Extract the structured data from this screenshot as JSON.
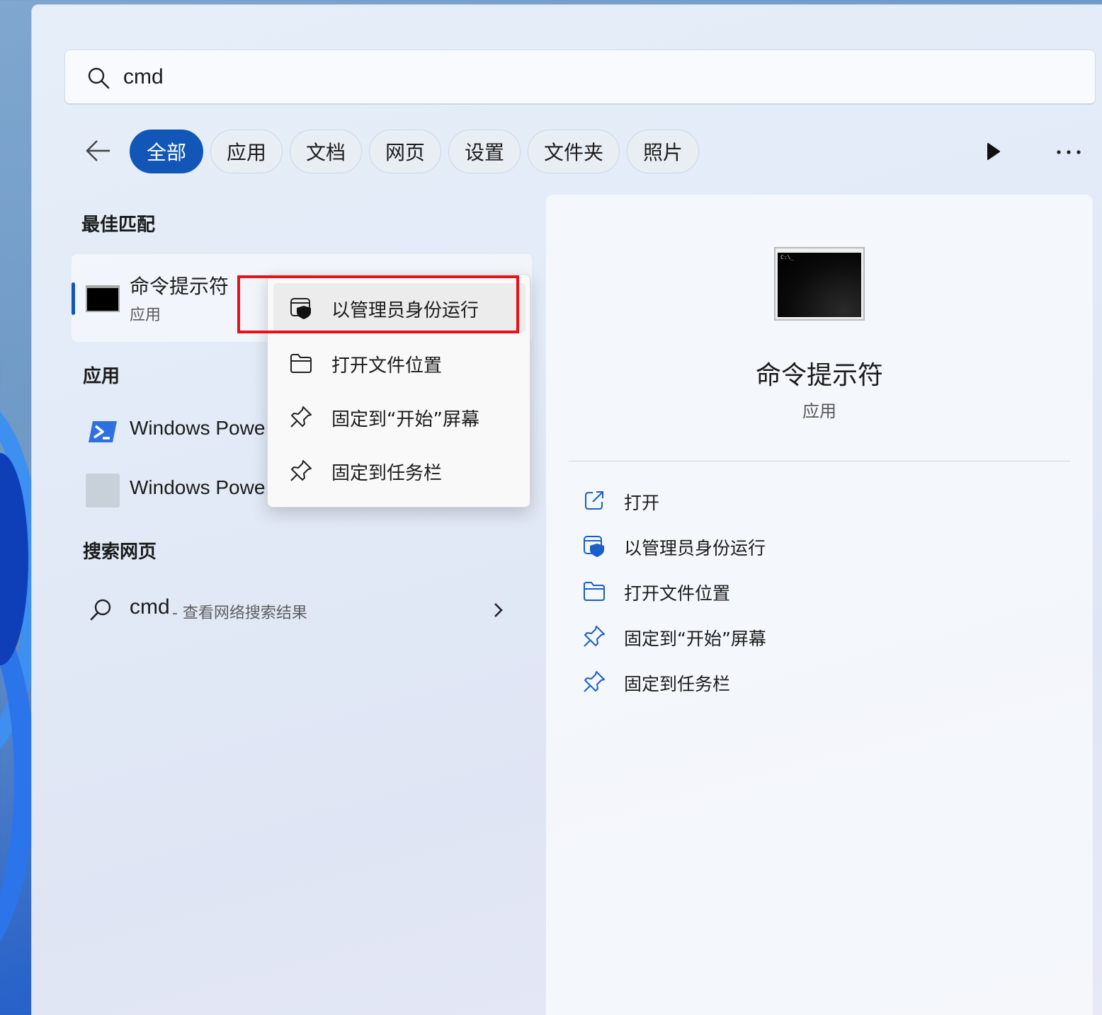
{
  "search": {
    "query": "cmd"
  },
  "filters": [
    "全部",
    "应用",
    "文档",
    "网页",
    "设置",
    "文件夹",
    "照片"
  ],
  "sections": {
    "best_match": "最佳匹配",
    "apps": "应用",
    "search_web": "搜索网页"
  },
  "best_match": {
    "name": "命令提示符",
    "type": "应用"
  },
  "apps": [
    {
      "label": "Windows Powe",
      "icon": "powershell-icon"
    },
    {
      "label": "Windows Powe",
      "icon": "app-placeholder-icon"
    }
  ],
  "web_search": {
    "query": "cmd",
    "suffix": "- 查看网络搜索结果"
  },
  "context_menu": [
    {
      "label": "以管理员身份运行",
      "icon": "admin-shield-icon"
    },
    {
      "label": "打开文件位置",
      "icon": "folder-icon"
    },
    {
      "label": "固定到“开始”屏幕",
      "icon": "pin-icon"
    },
    {
      "label": "固定到任务栏",
      "icon": "pin-icon"
    }
  ],
  "detail": {
    "title": "命令提示符",
    "subtitle": "应用",
    "icon_text": "C:\\_",
    "actions": [
      {
        "label": "打开",
        "icon": "open-external-icon"
      },
      {
        "label": "以管理员身份运行",
        "icon": "admin-shield-icon"
      },
      {
        "label": "打开文件位置",
        "icon": "folder-icon"
      },
      {
        "label": "固定到“开始”屏幕",
        "icon": "pin-icon"
      },
      {
        "label": "固定到任务栏",
        "icon": "pin-icon"
      }
    ]
  },
  "colors": {
    "accent": "#1257b8",
    "highlight": "#e8101a"
  }
}
